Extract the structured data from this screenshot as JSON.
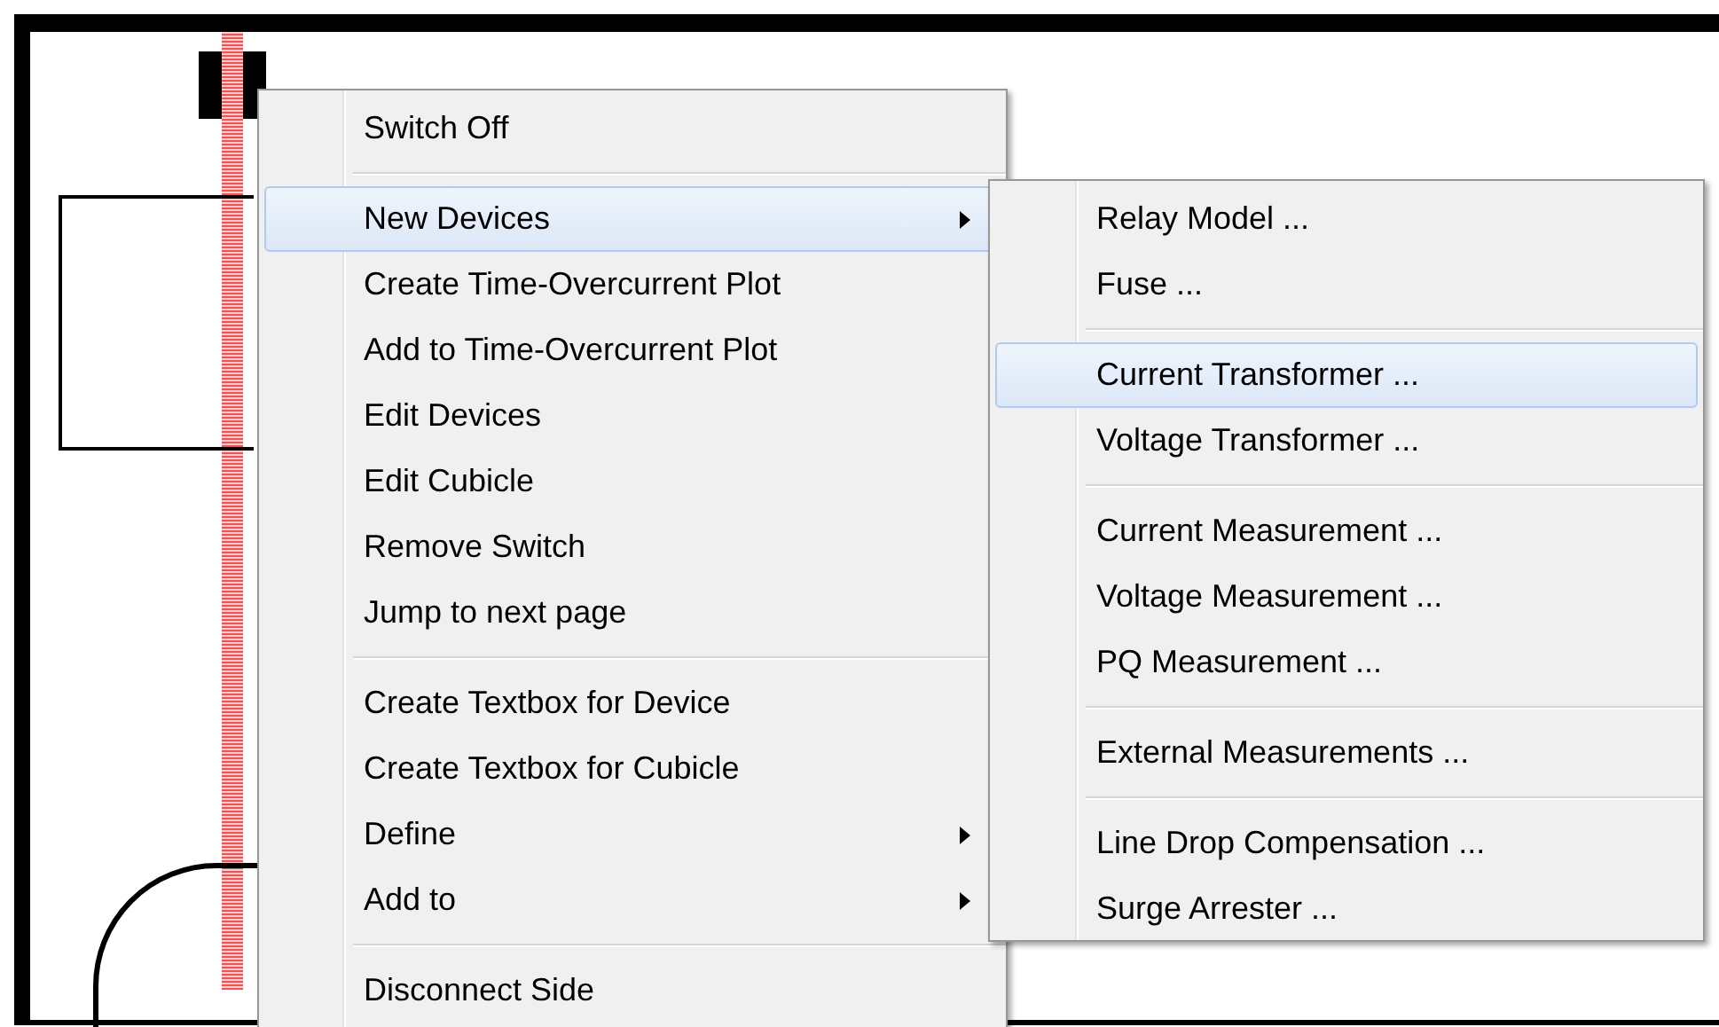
{
  "context_menu": {
    "items": [
      {
        "kind": "item",
        "label": "Switch Off",
        "selected": false,
        "submenu": false
      },
      {
        "kind": "separator"
      },
      {
        "kind": "item",
        "label": "New Devices",
        "selected": true,
        "submenu": true
      },
      {
        "kind": "item",
        "label": "Create Time-Overcurrent Plot",
        "selected": false,
        "submenu": false
      },
      {
        "kind": "item",
        "label": "Add to Time-Overcurrent Plot",
        "selected": false,
        "submenu": false
      },
      {
        "kind": "item",
        "label": "Edit Devices",
        "selected": false,
        "submenu": false
      },
      {
        "kind": "item",
        "label": "Edit Cubicle",
        "selected": false,
        "submenu": false
      },
      {
        "kind": "item",
        "label": "Remove Switch",
        "selected": false,
        "submenu": false
      },
      {
        "kind": "item",
        "label": "Jump to next page",
        "selected": false,
        "submenu": false
      },
      {
        "kind": "separator"
      },
      {
        "kind": "item",
        "label": "Create Textbox for Device",
        "selected": false,
        "submenu": false
      },
      {
        "kind": "item",
        "label": "Create Textbox for Cubicle",
        "selected": false,
        "submenu": false
      },
      {
        "kind": "item",
        "label": "Define",
        "selected": false,
        "submenu": true
      },
      {
        "kind": "item",
        "label": "Add to",
        "selected": false,
        "submenu": true
      },
      {
        "kind": "separator"
      },
      {
        "kind": "item",
        "label": "Disconnect Side",
        "selected": false,
        "submenu": false
      }
    ]
  },
  "submenu": {
    "items": [
      {
        "kind": "item",
        "label": "Relay Model ...",
        "selected": false
      },
      {
        "kind": "item",
        "label": "Fuse ...",
        "selected": false
      },
      {
        "kind": "separator"
      },
      {
        "kind": "item",
        "label": "Current Transformer ...",
        "selected": true
      },
      {
        "kind": "item",
        "label": "Voltage Transformer ...",
        "selected": false
      },
      {
        "kind": "separator"
      },
      {
        "kind": "item",
        "label": "Current Measurement ...",
        "selected": false
      },
      {
        "kind": "item",
        "label": "Voltage Measurement ...",
        "selected": false
      },
      {
        "kind": "item",
        "label": "PQ Measurement ...",
        "selected": false
      },
      {
        "kind": "separator"
      },
      {
        "kind": "item",
        "label": "External Measurements ...",
        "selected": false
      },
      {
        "kind": "separator"
      },
      {
        "kind": "item",
        "label": "Line Drop Compensation ...",
        "selected": false
      },
      {
        "kind": "item",
        "label": "Surge Arrester ...",
        "selected": false
      }
    ]
  }
}
